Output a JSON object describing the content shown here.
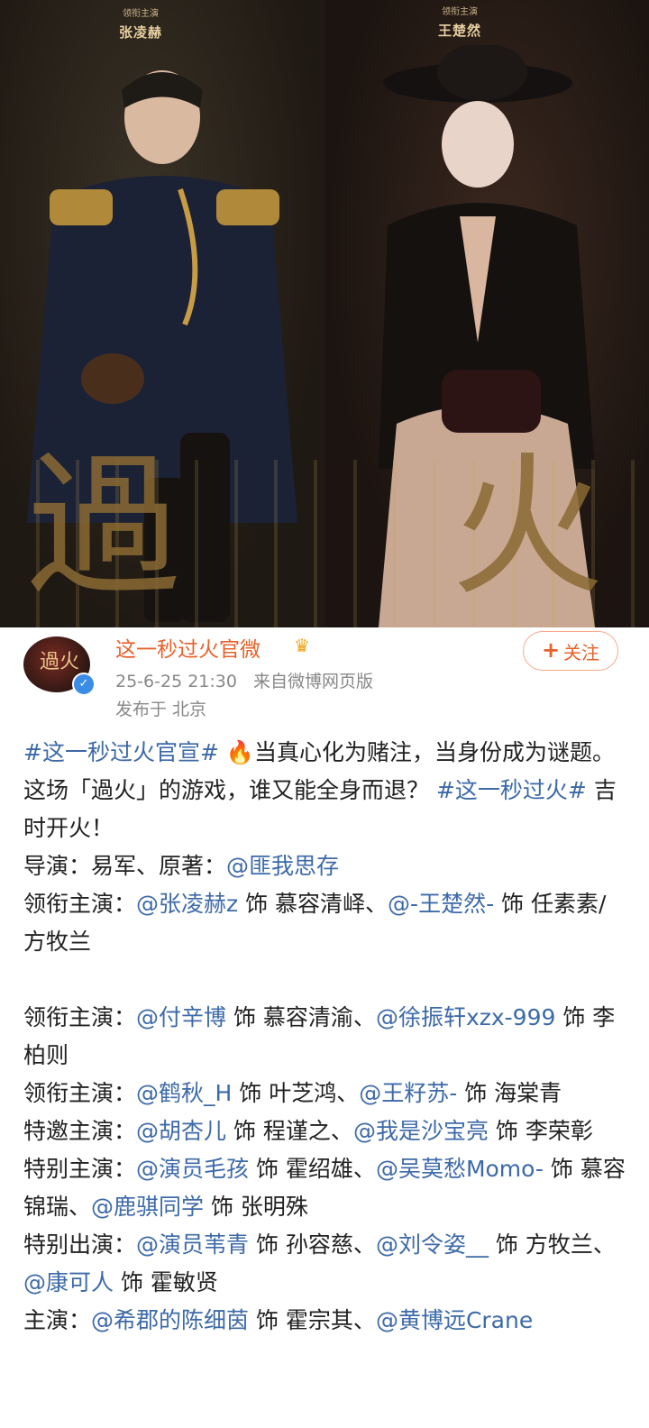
{
  "poster": {
    "left_credit": {
      "role": "领衔主演",
      "name": "张凌赫"
    },
    "right_credit": {
      "role": "领衔主演",
      "name": "王楚然"
    },
    "title_chars": [
      "過",
      "火"
    ]
  },
  "post": {
    "author": "这一秒过火官微",
    "avatar_text": "過火",
    "follow_label": "关注",
    "timestamp": "25-6-25 21:30",
    "source": "来自微博网页版",
    "location": "发布于 北京",
    "body": {
      "hashtag1": "#这一秒过火官宣#",
      "intro_text": "当真心化为赌注，当身份成为谜题。这场「過火」的游戏，谁又能全身而退？",
      "hashtag2": "#这一秒过火#",
      "intro_end": "吉时开火！",
      "director_label": "导演：易军、原著：",
      "author_link": "@匪我思存",
      "l1_label": "领衔主演：",
      "l1_a": "@张凌赫z",
      "l1_a_role": "饰 慕容清峄、",
      "l1_b": "@-王楚然-",
      "l1_b_role": "饰 任素素/方牧兰",
      "l2_label": "领衔主演：",
      "l2_a": "@付辛博",
      "l2_a_role": "饰 慕容清渝、",
      "l2_b": "@徐振轩xzx-999",
      "l2_b_role": "饰 李柏则",
      "l3_label": "领衔主演：",
      "l3_a": "@鹤秋_H",
      "l3_a_role": "饰 叶芝鸿、",
      "l3_b": "@王籽苏-",
      "l3_b_role": "饰 海棠青",
      "l4_label": "特邀主演：",
      "l4_a": "@胡杏儿",
      "l4_a_role": "饰 程谨之、",
      "l4_b": "@我是沙宝亮",
      "l4_b_role": "饰 李荣彰",
      "l5_label": "特别主演：",
      "l5_a": "@演员毛孩",
      "l5_a_role": "饰 霍绍雄、",
      "l5_b": "@吴莫愁Momo-",
      "l5_b_role": "饰 慕容锦瑞、",
      "l5_c": "@鹿骐同学",
      "l5_c_role": "饰 张明殊",
      "l6_label": "特别出演：",
      "l6_a": "@演员苇青",
      "l6_a_role": "饰 孙容慈、",
      "l6_b": "@刘令姿__",
      "l6_b_role": "饰 方牧兰、",
      "l6_c": "@康可人",
      "l6_c_role": "饰 霍敏贤",
      "l7_label": "主演：",
      "l7_a": "@希郡的陈细茵",
      "l7_a_role": "饰 霍宗其、",
      "l7_b": "@黄博远Crane"
    }
  },
  "colors": {
    "accent_orange": "#e8612a",
    "link_blue": "#3d6aa8",
    "meta_gray": "#888888"
  },
  "icons": [
    "crown-icon",
    "verified-icon",
    "plus-icon",
    "fire-icon"
  ]
}
